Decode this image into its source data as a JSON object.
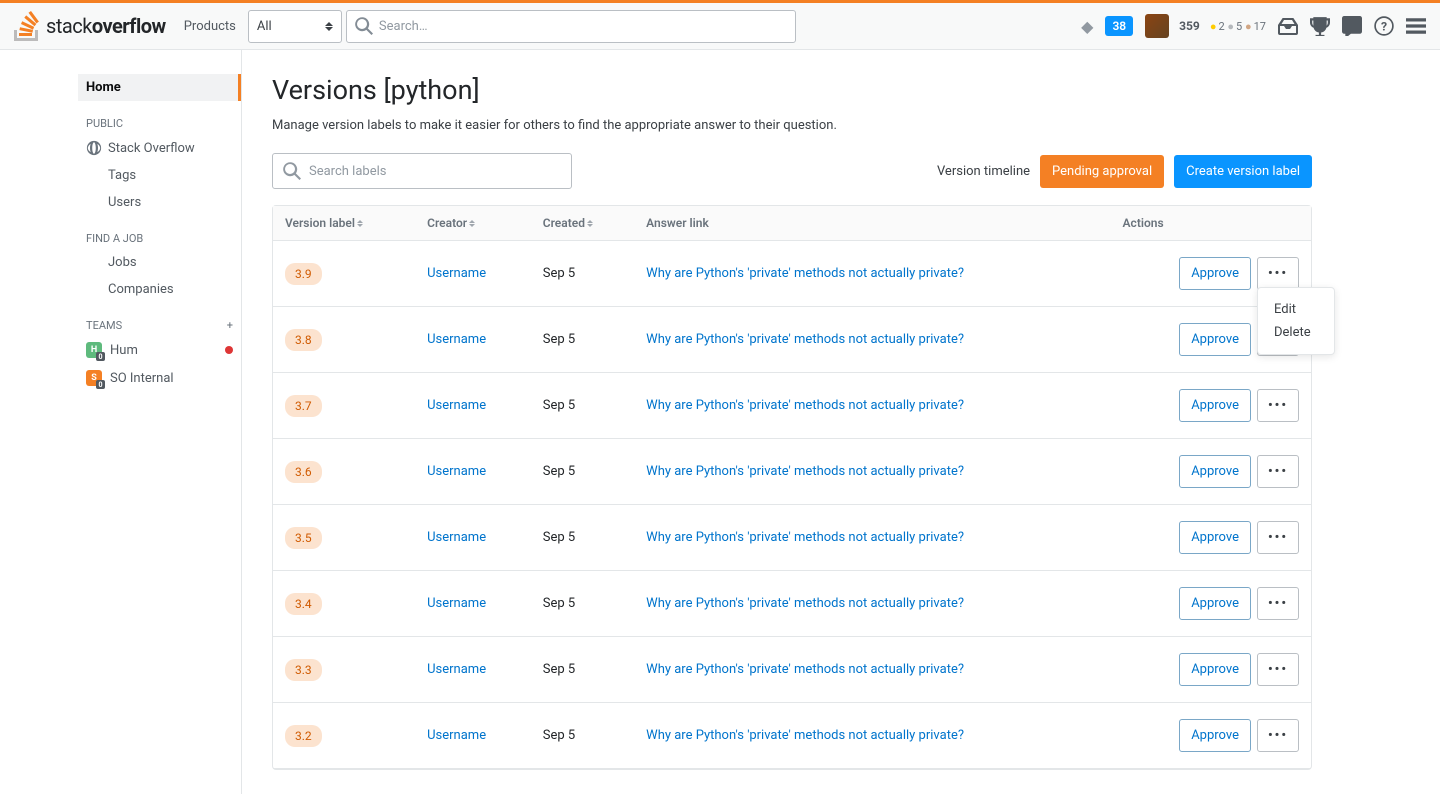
{
  "topbar": {
    "products": "Products",
    "scope": "All",
    "search_placeholder": "Search…",
    "review_count": "38",
    "reputation": "359",
    "badges": {
      "gold": "2",
      "silver": "5",
      "bronze": "17"
    }
  },
  "sidebar": {
    "home": "Home",
    "public_head": "PUBLIC",
    "stack_overflow": "Stack Overflow",
    "tags": "Tags",
    "users": "Users",
    "find_job_head": "FIND A JOB",
    "jobs": "Jobs",
    "companies": "Companies",
    "teams_head": "TEAMS",
    "teams": [
      {
        "name": "Hum",
        "color": "green",
        "has_dot": true
      },
      {
        "name": "SO Internal",
        "color": "orange",
        "has_dot": false
      }
    ]
  },
  "page": {
    "title": "Versions [python]",
    "subtitle": "Manage version labels to make it easier for others to find the appropriate answer to their question.",
    "search_placeholder": "Search labels",
    "version_timeline": "Version timeline",
    "pending_approval": "Pending approval",
    "create_label": "Create version label"
  },
  "table": {
    "headers": {
      "version": "Version label",
      "creator": "Creator",
      "created": "Created",
      "answer": "Answer link",
      "actions": "Actions"
    },
    "approve": "Approve",
    "rows": [
      {
        "v": "3.9",
        "creator": "Username",
        "created": "Sep 5",
        "answer": "Why are Python's 'private' methods not actually private?",
        "popover": true
      },
      {
        "v": "3.8",
        "creator": "Username",
        "created": "Sep 5",
        "answer": "Why are Python's 'private' methods not actually private?"
      },
      {
        "v": "3.7",
        "creator": "Username",
        "created": "Sep 5",
        "answer": "Why are Python's 'private' methods not actually private?"
      },
      {
        "v": "3.6",
        "creator": "Username",
        "created": "Sep 5",
        "answer": "Why are Python's 'private' methods not actually private?"
      },
      {
        "v": "3.5",
        "creator": "Username",
        "created": "Sep 5",
        "answer": "Why are Python's 'private' methods not actually private?"
      },
      {
        "v": "3.4",
        "creator": "Username",
        "created": "Sep 5",
        "answer": "Why are Python's 'private' methods not actually private?"
      },
      {
        "v": "3.3",
        "creator": "Username",
        "created": "Sep 5",
        "answer": "Why are Python's 'private' methods not actually private?"
      },
      {
        "v": "3.2",
        "creator": "Username",
        "created": "Sep 5",
        "answer": "Why are Python's 'private' methods not actually private?"
      }
    ]
  },
  "popover": {
    "edit": "Edit",
    "delete": "Delete"
  }
}
